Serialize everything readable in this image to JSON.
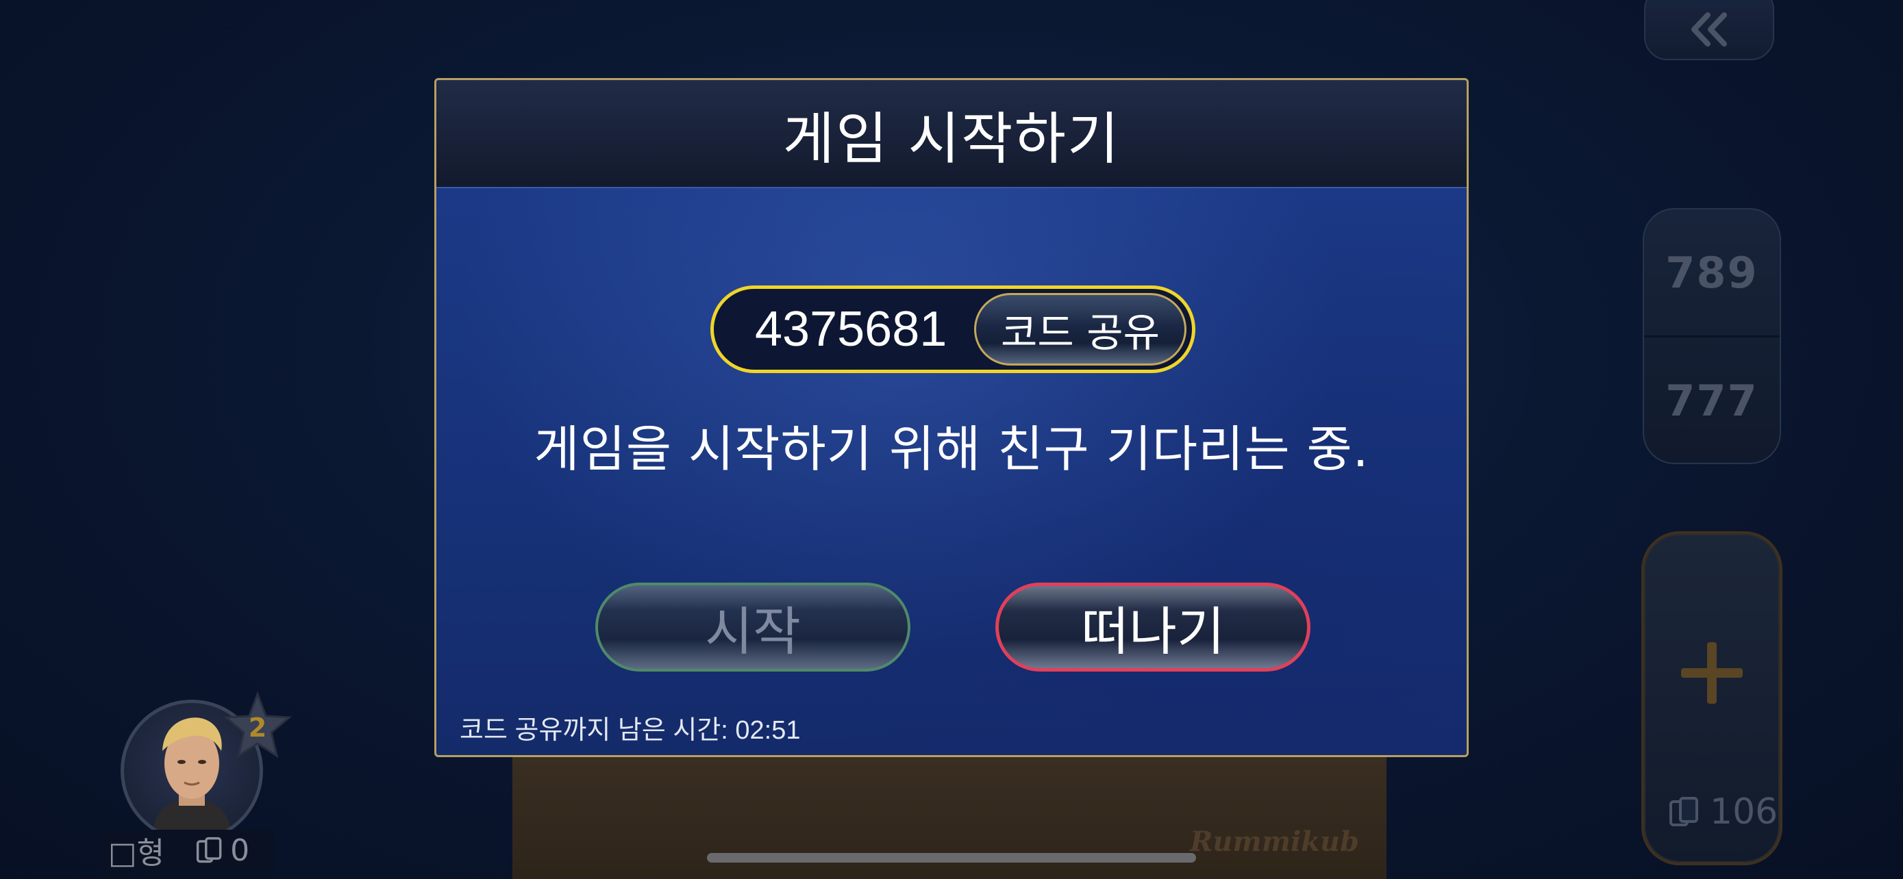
{
  "modal": {
    "title": "게임 시작하기",
    "room_code": "4375681",
    "share_label": "코드 공유",
    "waiting_message": "게임을 시작하기 위해 친구 기다리는 중.",
    "start_label": "시작",
    "leave_label": "떠나기",
    "timer_label": "코드 공유까지 남은 시간: 02:51"
  },
  "side_panel": {
    "sort_run_label": "789",
    "sort_group_label": "777",
    "pool_tiles_count": "106"
  },
  "player": {
    "name": "□형",
    "tiles_count": "0",
    "level": "2"
  },
  "rack": {
    "logo": "Rummikub"
  },
  "colors": {
    "code_border": "#f0d52a",
    "leave_border": "#e0405a",
    "start_border": "#4f8a6a",
    "modal_border": "#b7a062"
  }
}
